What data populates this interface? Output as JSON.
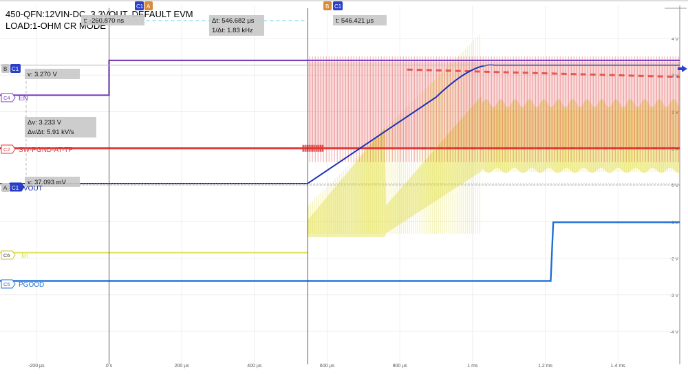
{
  "title": {
    "line1": "450-QFN:12VIN-DC, 3.3VOUT, DEFAULT EVM",
    "line2": "LOAD:1-OHM CR MODE"
  },
  "cursors": {
    "a": {
      "letter": "A",
      "channel": "C1",
      "t_label": "t: -260.870 ns"
    },
    "b": {
      "letter": "B",
      "channel": "C1",
      "t_label": "t: 546.421 µs"
    },
    "delta_t": "Δt: 546.682 µs",
    "inv_delta_t": "1/Δt: 1.83 kHz",
    "b_v": "v: 3.270 V",
    "a_v": "v: 37.093 mV",
    "delta_v": "Δv: 3.233 V",
    "slew": "Δv/Δt: 5.91 kV/s"
  },
  "channel_labels": {
    "en": {
      "tag": "C4",
      "name": "EN",
      "color": "#7b3fc4"
    },
    "sw": {
      "tag": "C2",
      "name": "SW-PGND-AT-TP",
      "color": "#e03a3a"
    },
    "vout": {
      "tag": "C1",
      "name": "VOUT",
      "color": "#1a2fb5"
    },
    "iin": {
      "tag": "C6",
      "name": "Iin",
      "color": "#e2e04a"
    },
    "pgood": {
      "tag": "C5",
      "name": "PGOOD",
      "color": "#1f6fd6"
    }
  },
  "chart_data": {
    "type": "line",
    "title": "450-QFN:12VIN-DC, 3.3VOUT, DEFAULT EVM / LOAD:1-OHM CR MODE",
    "xlabel": "",
    "ylabel": "",
    "x_unit": "µs",
    "xlim": [
      -300,
      1570
    ],
    "ylim": [
      -4.9,
      4.9
    ],
    "x_ticks": [
      {
        "v": -200,
        "label": "-200 µs"
      },
      {
        "v": 0,
        "label": "0 s"
      },
      {
        "v": 200,
        "label": "200 µs"
      },
      {
        "v": 400,
        "label": "400 µs"
      },
      {
        "v": 600,
        "label": "600 µs"
      },
      {
        "v": 800,
        "label": "800 µs"
      },
      {
        "v": 1000,
        "label": "1 ms"
      },
      {
        "v": 1200,
        "label": "1.2 ms"
      },
      {
        "v": 1400,
        "label": "1.4 ms"
      }
    ],
    "y_ticks": [
      {
        "v": 4,
        "label": "4 V"
      },
      {
        "v": 3,
        "label": "3 V"
      },
      {
        "v": 2,
        "label": "2 V"
      },
      {
        "v": 1,
        "label": "1 V"
      },
      {
        "v": 0,
        "label": "0 V"
      },
      {
        "v": -1,
        "label": "-1 V"
      },
      {
        "v": -2,
        "label": "-2 V"
      },
      {
        "v": -3,
        "label": "-3 V"
      },
      {
        "v": -4,
        "label": "-4 V"
      }
    ],
    "cursor_x": [
      0,
      546.4
    ],
    "cursor_y": [
      3.27,
      0.037
    ],
    "series": [
      {
        "name": "EN",
        "color": "#7b3fc4",
        "x": [
          -300,
          0,
          0,
          1570
        ],
        "y": [
          2.45,
          2.45,
          3.4,
          3.4
        ]
      },
      {
        "name": "SW-PGND-AT-TP",
        "color": "#e03a3a",
        "x": [
          -300,
          1570
        ],
        "y": [
          1.0,
          1.0
        ]
      },
      {
        "name": "VOUT",
        "color": "#1a2fb5",
        "x": [
          -300,
          546,
          900,
          1000,
          1060,
          1570
        ],
        "y": [
          0.037,
          0.037,
          2.4,
          3.1,
          3.27,
          3.27
        ]
      },
      {
        "name": "Iin",
        "color": "#e2e04a",
        "x": [
          -300,
          546
        ],
        "y": [
          -1.85,
          -1.85
        ]
      },
      {
        "name": "PGOOD",
        "color": "#1f6fd6",
        "x": [
          -300,
          1215,
          1222,
          1570
        ],
        "y": [
          -2.62,
          -2.62,
          -1.02,
          -1.02
        ]
      }
    ]
  }
}
